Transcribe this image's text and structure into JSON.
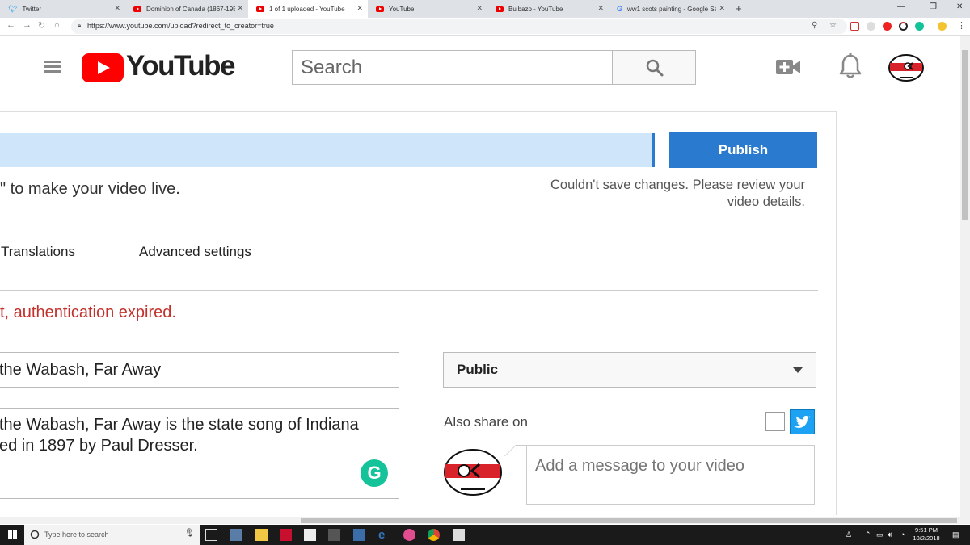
{
  "browser": {
    "tabs": [
      {
        "title": "Twitter",
        "favicon": "twitter-icon"
      },
      {
        "title": "Dominion of Canada (1867-1953",
        "favicon": "youtube-icon"
      },
      {
        "title": "1 of 1 uploaded - YouTube",
        "favicon": "youtube-icon",
        "active": true
      },
      {
        "title": "YouTube",
        "favicon": "youtube-icon"
      },
      {
        "title": "Bulbazo - YouTube",
        "favicon": "youtube-icon"
      },
      {
        "title": "ww1 scots painting - Google Sea",
        "favicon": "google-icon"
      }
    ],
    "url": "https://www.youtube.com/upload?redirect_to_creator=true"
  },
  "header": {
    "logo_text": "YouTube",
    "search_placeholder": "Search"
  },
  "upload": {
    "publish_label": "Publish",
    "live_message": "\" to make your video live.",
    "save_error": "Couldn't save changes. Please review your video details.",
    "tabs": [
      "Translations",
      "Advanced settings"
    ],
    "auth_error": "t, authentication expired.",
    "title_value": "the Wabash, Far Away",
    "description_value": "the Wabash, Far Away is the state song of Indiana\ned in 1897 by Paul Dresser.",
    "privacy_value": "Public",
    "also_share_label": "Also share on",
    "message_placeholder": "Add a message to your video"
  },
  "taskbar": {
    "search_placeholder": "Type here to search",
    "time": "9:51 PM",
    "date": "10/2/2018"
  },
  "colors": {
    "accent": "#2a7bd0",
    "error": "#c3312c",
    "youtube_red": "#ff0000",
    "twitter": "#1da1f2"
  }
}
